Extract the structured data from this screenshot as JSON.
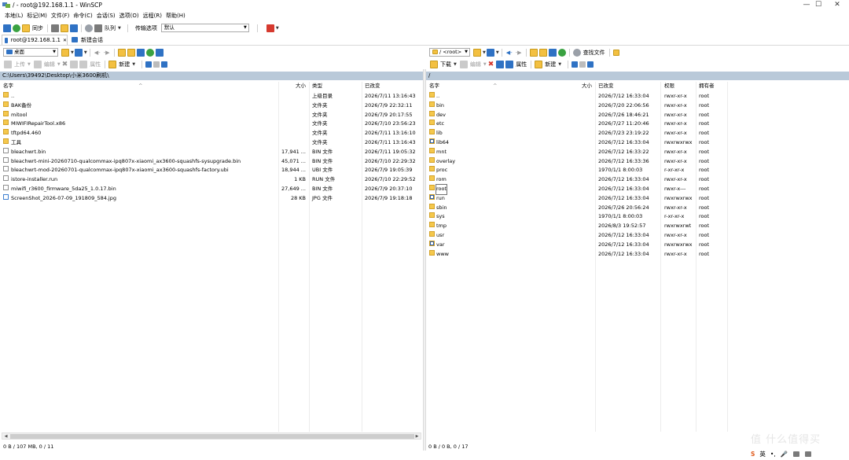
{
  "window": {
    "title": "/ - root@192.168.1.1 - WinSCP",
    "controls": {
      "minimize": "—",
      "maximize": "☐",
      "close": "✕"
    }
  },
  "menu": [
    "本地(L)",
    "标记(M)",
    "文件(F)",
    "命令(C)",
    "会话(S)",
    "选项(O)",
    "远程(R)",
    "帮助(H)"
  ],
  "toolbar": {
    "sync_label": "同步",
    "queue_label": "队列",
    "transfer_label": "传输选项",
    "transfer_value": "默认"
  },
  "tabs": {
    "session": "root@192.168.1.1",
    "close_glyph": "✕",
    "new_session": "新建会话"
  },
  "left": {
    "drive": "桌面",
    "upload": "上传",
    "edit": "编辑",
    "properties": "属性",
    "new": "新建",
    "path": "C:\\Users\\39492\\Desktop\\小米3600刷机\\",
    "headers": {
      "name": "名字",
      "size": "大小",
      "type": "类型",
      "modified": "已改变"
    },
    "files": [
      {
        "icon": "up",
        "name": "..",
        "size": "",
        "type": "上级目录",
        "modified": "2026/7/11  13:16:43"
      },
      {
        "icon": "folder",
        "name": "BAK备份",
        "size": "",
        "type": "文件夹",
        "modified": "2026/7/9  22:32:11"
      },
      {
        "icon": "folder",
        "name": "mitool",
        "size": "",
        "type": "文件夹",
        "modified": "2026/7/9  20:17:55"
      },
      {
        "icon": "folder",
        "name": "MIWIFIRepairTool.x86",
        "size": "",
        "type": "文件夹",
        "modified": "2026/7/10  23:56:23"
      },
      {
        "icon": "folder",
        "name": "tftpd64.460",
        "size": "",
        "type": "文件夹",
        "modified": "2026/7/11  13:16:10"
      },
      {
        "icon": "folder",
        "name": "工具",
        "size": "",
        "type": "文件夹",
        "modified": "2026/7/11  13:16:43"
      },
      {
        "icon": "file",
        "name": "bleachwrt.bin",
        "size": "17,941 ...",
        "type": "BIN 文件",
        "modified": "2026/7/11  19:05:32"
      },
      {
        "icon": "file",
        "name": "bleachwrt-mini-20260710-qualcommax-ipq807x-xiaomi_ax3600-squashfs-sysupgrade.bin",
        "size": "45,071 ...",
        "type": "BIN 文件",
        "modified": "2026/7/10  22:29:32"
      },
      {
        "icon": "file",
        "name": "bleachwrt-mod-20260701-qualcommax-ipq807x-xiaomi_ax3600-squashfs-factory.ubi",
        "size": "18,944 ...",
        "type": "UBI 文件",
        "modified": "2026/7/9  19:05:39"
      },
      {
        "icon": "file",
        "name": "istore-installer.run",
        "size": "1 KB",
        "type": "RUN 文件",
        "modified": "2026/7/10  22:29:52"
      },
      {
        "icon": "file",
        "name": "miwifi_r3600_firmware_5da25_1.0.17.bin",
        "size": "27,649 ...",
        "type": "BIN 文件",
        "modified": "2026/7/9  20:37:10"
      },
      {
        "icon": "img",
        "name": "ScreenShot_2026-07-09_191809_584.jpg",
        "size": "28 KB",
        "type": "JPG 文件",
        "modified": "2026/7/9  19:18:18"
      }
    ],
    "status": "0 B / 107 MB,   0 / 11"
  },
  "right": {
    "location": "/ <root>",
    "download": "下载",
    "edit": "编辑",
    "properties": "属性",
    "new": "新建",
    "find": "查找文件",
    "path": "/",
    "headers": {
      "name": "名字",
      "size": "大小",
      "modified": "已改变",
      "rights": "权限",
      "owner": "拥有者"
    },
    "files": [
      {
        "icon": "up",
        "name": "..",
        "modified": "2026/7/12 16:33:04",
        "rights": "rwxr-xr-x",
        "owner": "root"
      },
      {
        "icon": "folder",
        "name": "bin",
        "modified": "2026/7/20 22:06:56",
        "rights": "rwxr-xr-x",
        "owner": "root"
      },
      {
        "icon": "folder",
        "name": "dev",
        "modified": "2026/7/26 18:46:21",
        "rights": "rwxr-xr-x",
        "owner": "root"
      },
      {
        "icon": "folder",
        "name": "etc",
        "modified": "2026/7/27 11:20:46",
        "rights": "rwxr-xr-x",
        "owner": "root"
      },
      {
        "icon": "folder",
        "name": "lib",
        "modified": "2026/7/23 23:19:22",
        "rights": "rwxr-xr-x",
        "owner": "root"
      },
      {
        "icon": "link",
        "name": "lib64",
        "modified": "2026/7/12 16:33:04",
        "rights": "rwxrwxrwx",
        "owner": "root"
      },
      {
        "icon": "folder",
        "name": "mnt",
        "modified": "2026/7/12 16:33:22",
        "rights": "rwxr-xr-x",
        "owner": "root"
      },
      {
        "icon": "folder",
        "name": "overlay",
        "modified": "2026/7/12 16:33:36",
        "rights": "rwxr-xr-x",
        "owner": "root"
      },
      {
        "icon": "folder",
        "name": "proc",
        "modified": "1970/1/1 8:00:03",
        "rights": "r-xr-xr-x",
        "owner": "root"
      },
      {
        "icon": "folder",
        "name": "rom",
        "modified": "2026/7/12 16:33:04",
        "rights": "rwxr-xr-x",
        "owner": "root"
      },
      {
        "icon": "folder",
        "name": "root",
        "modified": "2026/7/12 16:33:04",
        "rights": "rwxr-x---",
        "owner": "root"
      },
      {
        "icon": "link",
        "name": "run",
        "modified": "2026/7/12 16:33:04",
        "rights": "rwxrwxrwx",
        "owner": "root"
      },
      {
        "icon": "folder",
        "name": "sbin",
        "modified": "2026/7/26 20:56:24",
        "rights": "rwxr-xr-x",
        "owner": "root"
      },
      {
        "icon": "folder",
        "name": "sys",
        "modified": "1970/1/1 8:00:03",
        "rights": "r-xr-xr-x",
        "owner": "root"
      },
      {
        "icon": "folder",
        "name": "tmp",
        "modified": "2026/8/3 19:52:57",
        "rights": "rwxrwxrwt",
        "owner": "root"
      },
      {
        "icon": "folder",
        "name": "usr",
        "modified": "2026/7/12 16:33:04",
        "rights": "rwxr-xr-x",
        "owner": "root"
      },
      {
        "icon": "link",
        "name": "var",
        "modified": "2026/7/12 16:33:04",
        "rights": "rwxrwxrwx",
        "owner": "root"
      },
      {
        "icon": "folder",
        "name": "www",
        "modified": "2026/7/12 16:33:04",
        "rights": "rwxr-xr-x",
        "owner": "root"
      }
    ],
    "status": "0 B / 0 B,   0 / 17"
  },
  "taskbar": {
    "ime": "英",
    "punct": "•,",
    "mic": "🎤"
  },
  "watermark": "值 什么值得买"
}
